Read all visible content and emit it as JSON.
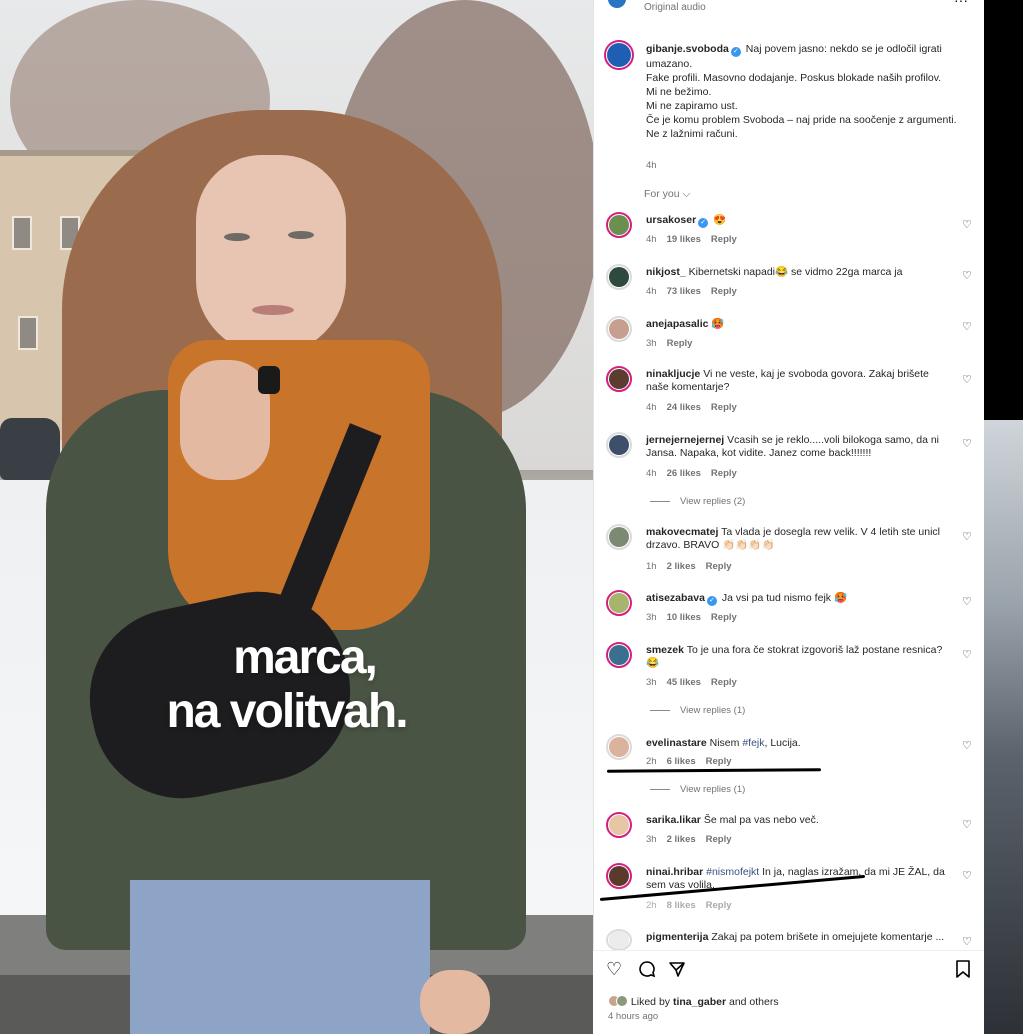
{
  "video": {
    "caption_line1": "marca,",
    "caption_line2": "na volitvah."
  },
  "header": {
    "audio": "Original audio"
  },
  "post": {
    "author": "gibanje.svoboda",
    "caption": "Naj povem jasno: nekdo se je odločil igrati umazano.\nFake profili. Masovno dodajanje. Poskus blokade naših profilov.\nMi ne bežimo.\nMi ne zapiramo ust.\nČe je komu problem Svoboda – naj pride na soočenje z argumenti.\nNe z lažnimi računi.",
    "time": "4h",
    "sort_label": "For you ⌵"
  },
  "comments": [
    {
      "user": "ursakoser",
      "verified": true,
      "text": "😍",
      "time": "4h",
      "likes": "19 likes",
      "reply": "Reply",
      "avatar_color": "#6b8f4e"
    },
    {
      "user": "nikjost_",
      "verified": false,
      "text": "Kibernetski napadi😂 se vidmo 22ga marca ja",
      "time": "4h",
      "likes": "73 likes",
      "reply": "Reply",
      "avatar_color": "#2d4a3c"
    },
    {
      "user": "anejapasalic",
      "verified": false,
      "text": "🥵",
      "time": "3h",
      "likes": "",
      "reply": "Reply",
      "avatar_color": "#c79f91"
    },
    {
      "user": "ninakljucje",
      "verified": false,
      "text": "Vi ne veste, kaj je svoboda govora. Zakaj brišete naše komentarje?",
      "time": "4h",
      "likes": "24 likes",
      "reply": "Reply",
      "avatar_color": "#5a3d2e"
    },
    {
      "user": "jernejernejernej",
      "verified": false,
      "text": "Vcasih se je reklo.....voli bilokoga samo, da ni Jansa. Napaka, kot vidite. Janez come back!!!!!!!",
      "time": "4h",
      "likes": "26 likes",
      "reply": "Reply",
      "avatar_color": "#3d4f6b",
      "view_replies": "View replies (2)"
    },
    {
      "user": "makovecmatej",
      "verified": false,
      "text": "Ta vlada je dosegla rew velik. V 4 letih ste unicl drzavo. BRAVO 👏🏻👏🏻👏🏻👏🏻",
      "time": "1h",
      "likes": "2 likes",
      "reply": "Reply",
      "avatar_color": "#7c8a74"
    },
    {
      "user": "atisezabava",
      "verified": true,
      "text": "Ja vsi pa tud nismo fejk 🥵",
      "time": "3h",
      "likes": "10 likes",
      "reply": "Reply",
      "avatar_color": "#a7b46b"
    },
    {
      "user": "smezek",
      "verified": false,
      "text": "To je una fora če stokrat izgovoriš laž postane resnica? 😂",
      "time": "3h",
      "likes": "45 likes",
      "reply": "Reply",
      "avatar_color": "#3a6f8f",
      "view_replies": "View replies (1)"
    },
    {
      "user": "evelinastare",
      "verified": false,
      "text_pre": "Nisem ",
      "tag": "#fejk",
      "text_post": ", Lucija.",
      "time": "2h",
      "likes": "6 likes",
      "reply": "Reply",
      "avatar_color": "#d9b39b",
      "view_replies": "View replies (1)"
    },
    {
      "user": "sarika.likar",
      "verified": false,
      "text": "Še mal pa vas nebo več.",
      "time": "3h",
      "likes": "2 likes",
      "reply": "Reply",
      "avatar_color": "#e6c6a5"
    },
    {
      "user": "ninai.hribar",
      "verified": false,
      "tag": "#nismofejkt",
      "text_post": " In ja, naglas izražam, da mi JE ŽAL, da sem vas volila.",
      "time": "2h",
      "likes": "8 likes",
      "reply": "Reply",
      "avatar_color": "#5b3a2c"
    },
    {
      "user": "pigmenterija",
      "verified": false,
      "text": "Zakaj pa potem brišete in omejujete komentarje ...",
      "avatar_color": "#f0f0f0"
    }
  ],
  "footer": {
    "liked_prefix": "Liked by ",
    "liked_user": "tina_gaber",
    "liked_suffix": " and others",
    "posted": "4 hours ago"
  }
}
